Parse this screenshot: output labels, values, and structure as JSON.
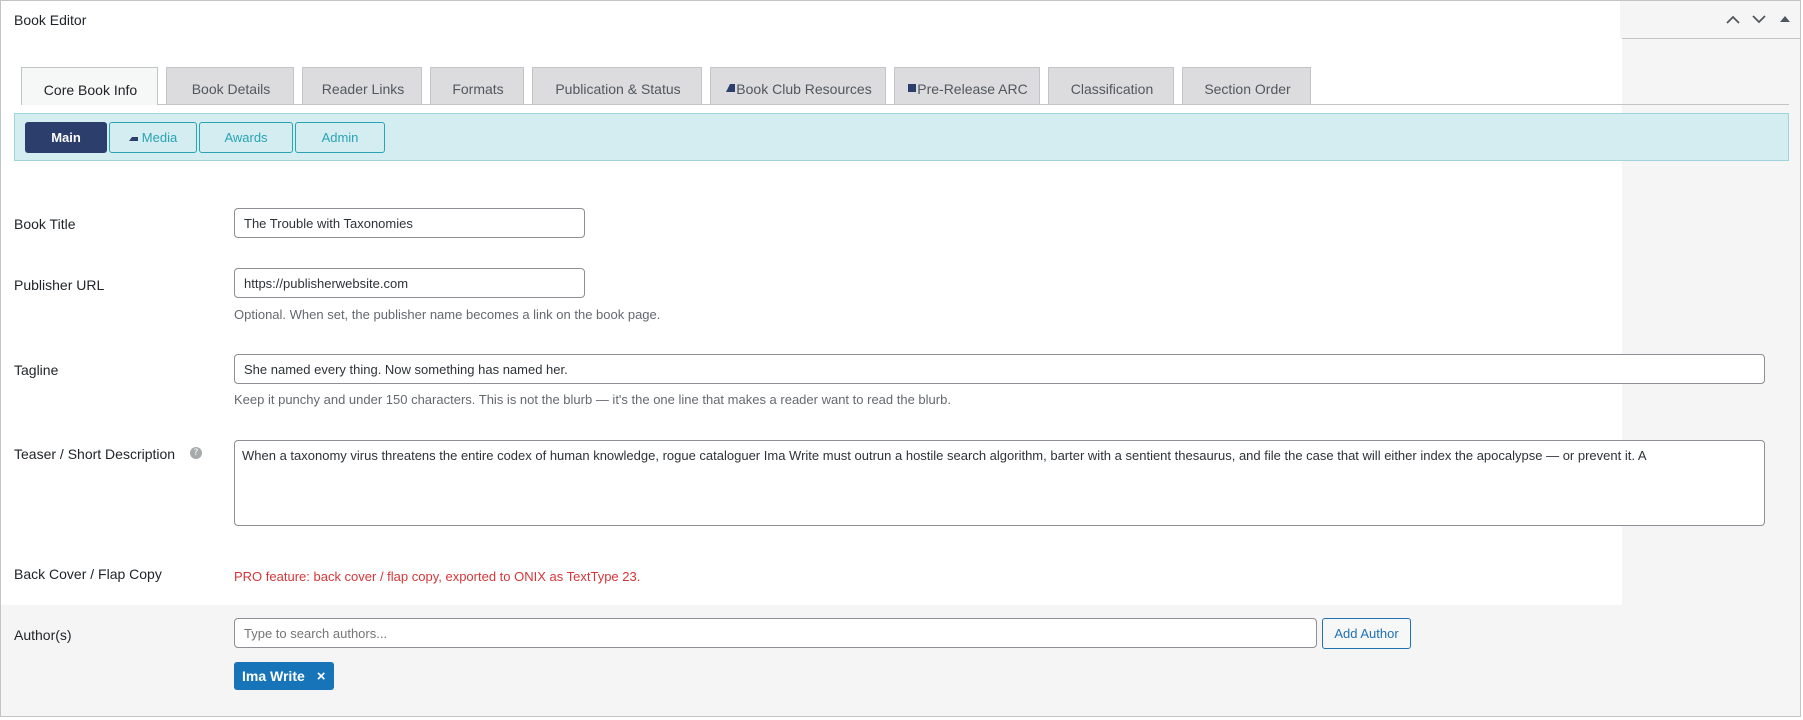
{
  "window": {
    "title": "Book Editor",
    "controls": [
      "move-up-icon",
      "move-down-icon",
      "toggle-panel-icon"
    ]
  },
  "tabs": [
    {
      "label": "Core Book Info",
      "active": true,
      "icon": ""
    },
    {
      "label": "Book Details",
      "active": false,
      "icon": ""
    },
    {
      "label": "Reader Links",
      "active": false,
      "icon": ""
    },
    {
      "label": "Formats",
      "active": false,
      "icon": ""
    },
    {
      "label": "Publication & Status",
      "active": false,
      "icon": ""
    },
    {
      "label": "Book Club Resources",
      "active": false,
      "icon": "book-club-icon"
    },
    {
      "label": "Pre-Release ARC",
      "active": false,
      "icon": "arc-square-icon"
    },
    {
      "label": "Classification",
      "active": false,
      "icon": ""
    },
    {
      "label": "Section Order",
      "active": false,
      "icon": ""
    }
  ],
  "subtabs": [
    {
      "label": "Main",
      "active": true,
      "icon": ""
    },
    {
      "label": "Media",
      "active": false,
      "icon": "media-icon"
    },
    {
      "label": "Awards",
      "active": false,
      "icon": ""
    },
    {
      "label": "Admin",
      "active": false,
      "icon": ""
    }
  ],
  "form": {
    "book_title": {
      "label": "Book Title",
      "value": "The Trouble with Taxonomies"
    },
    "publisher_url": {
      "label": "Publisher URL",
      "value": "https://publisherwebsite.com",
      "description": "Optional. When set, the publisher name becomes a link on the book page."
    },
    "tagline": {
      "label": "Tagline",
      "value": "She named every thing. Now something has named her.",
      "description": "Keep it punchy and under 150 characters. This is not the blurb — it's the one line that makes a reader want to read the blurb."
    },
    "teaser": {
      "label": "Teaser / Short Description",
      "help": "?",
      "value": "When a taxonomy virus threatens the entire codex of human knowledge, rogue cataloguer Ima Write must outrun a hostile search algorithm, barter with a sentient thesaurus, and file the case that will either index the apocalypse — or prevent it. A"
    },
    "back_cover": {
      "label": "Back Cover / Flap Copy",
      "pro_notice": "PRO feature: back cover / flap copy, exported to ONIX as TextType 23."
    },
    "authors": {
      "label": "Author(s)",
      "placeholder": "Type to search authors...",
      "add_button": "Add Author",
      "selected": [
        {
          "name": "Ima Write",
          "remove": "×"
        }
      ]
    }
  },
  "colors": {
    "navy": "#2c3e6b",
    "teal": "#2aa3b5",
    "subbar_bg": "#d3edf1",
    "wp_blue": "#2271b1",
    "chip_blue": "#1874b8",
    "pro_red": "#d63638"
  }
}
